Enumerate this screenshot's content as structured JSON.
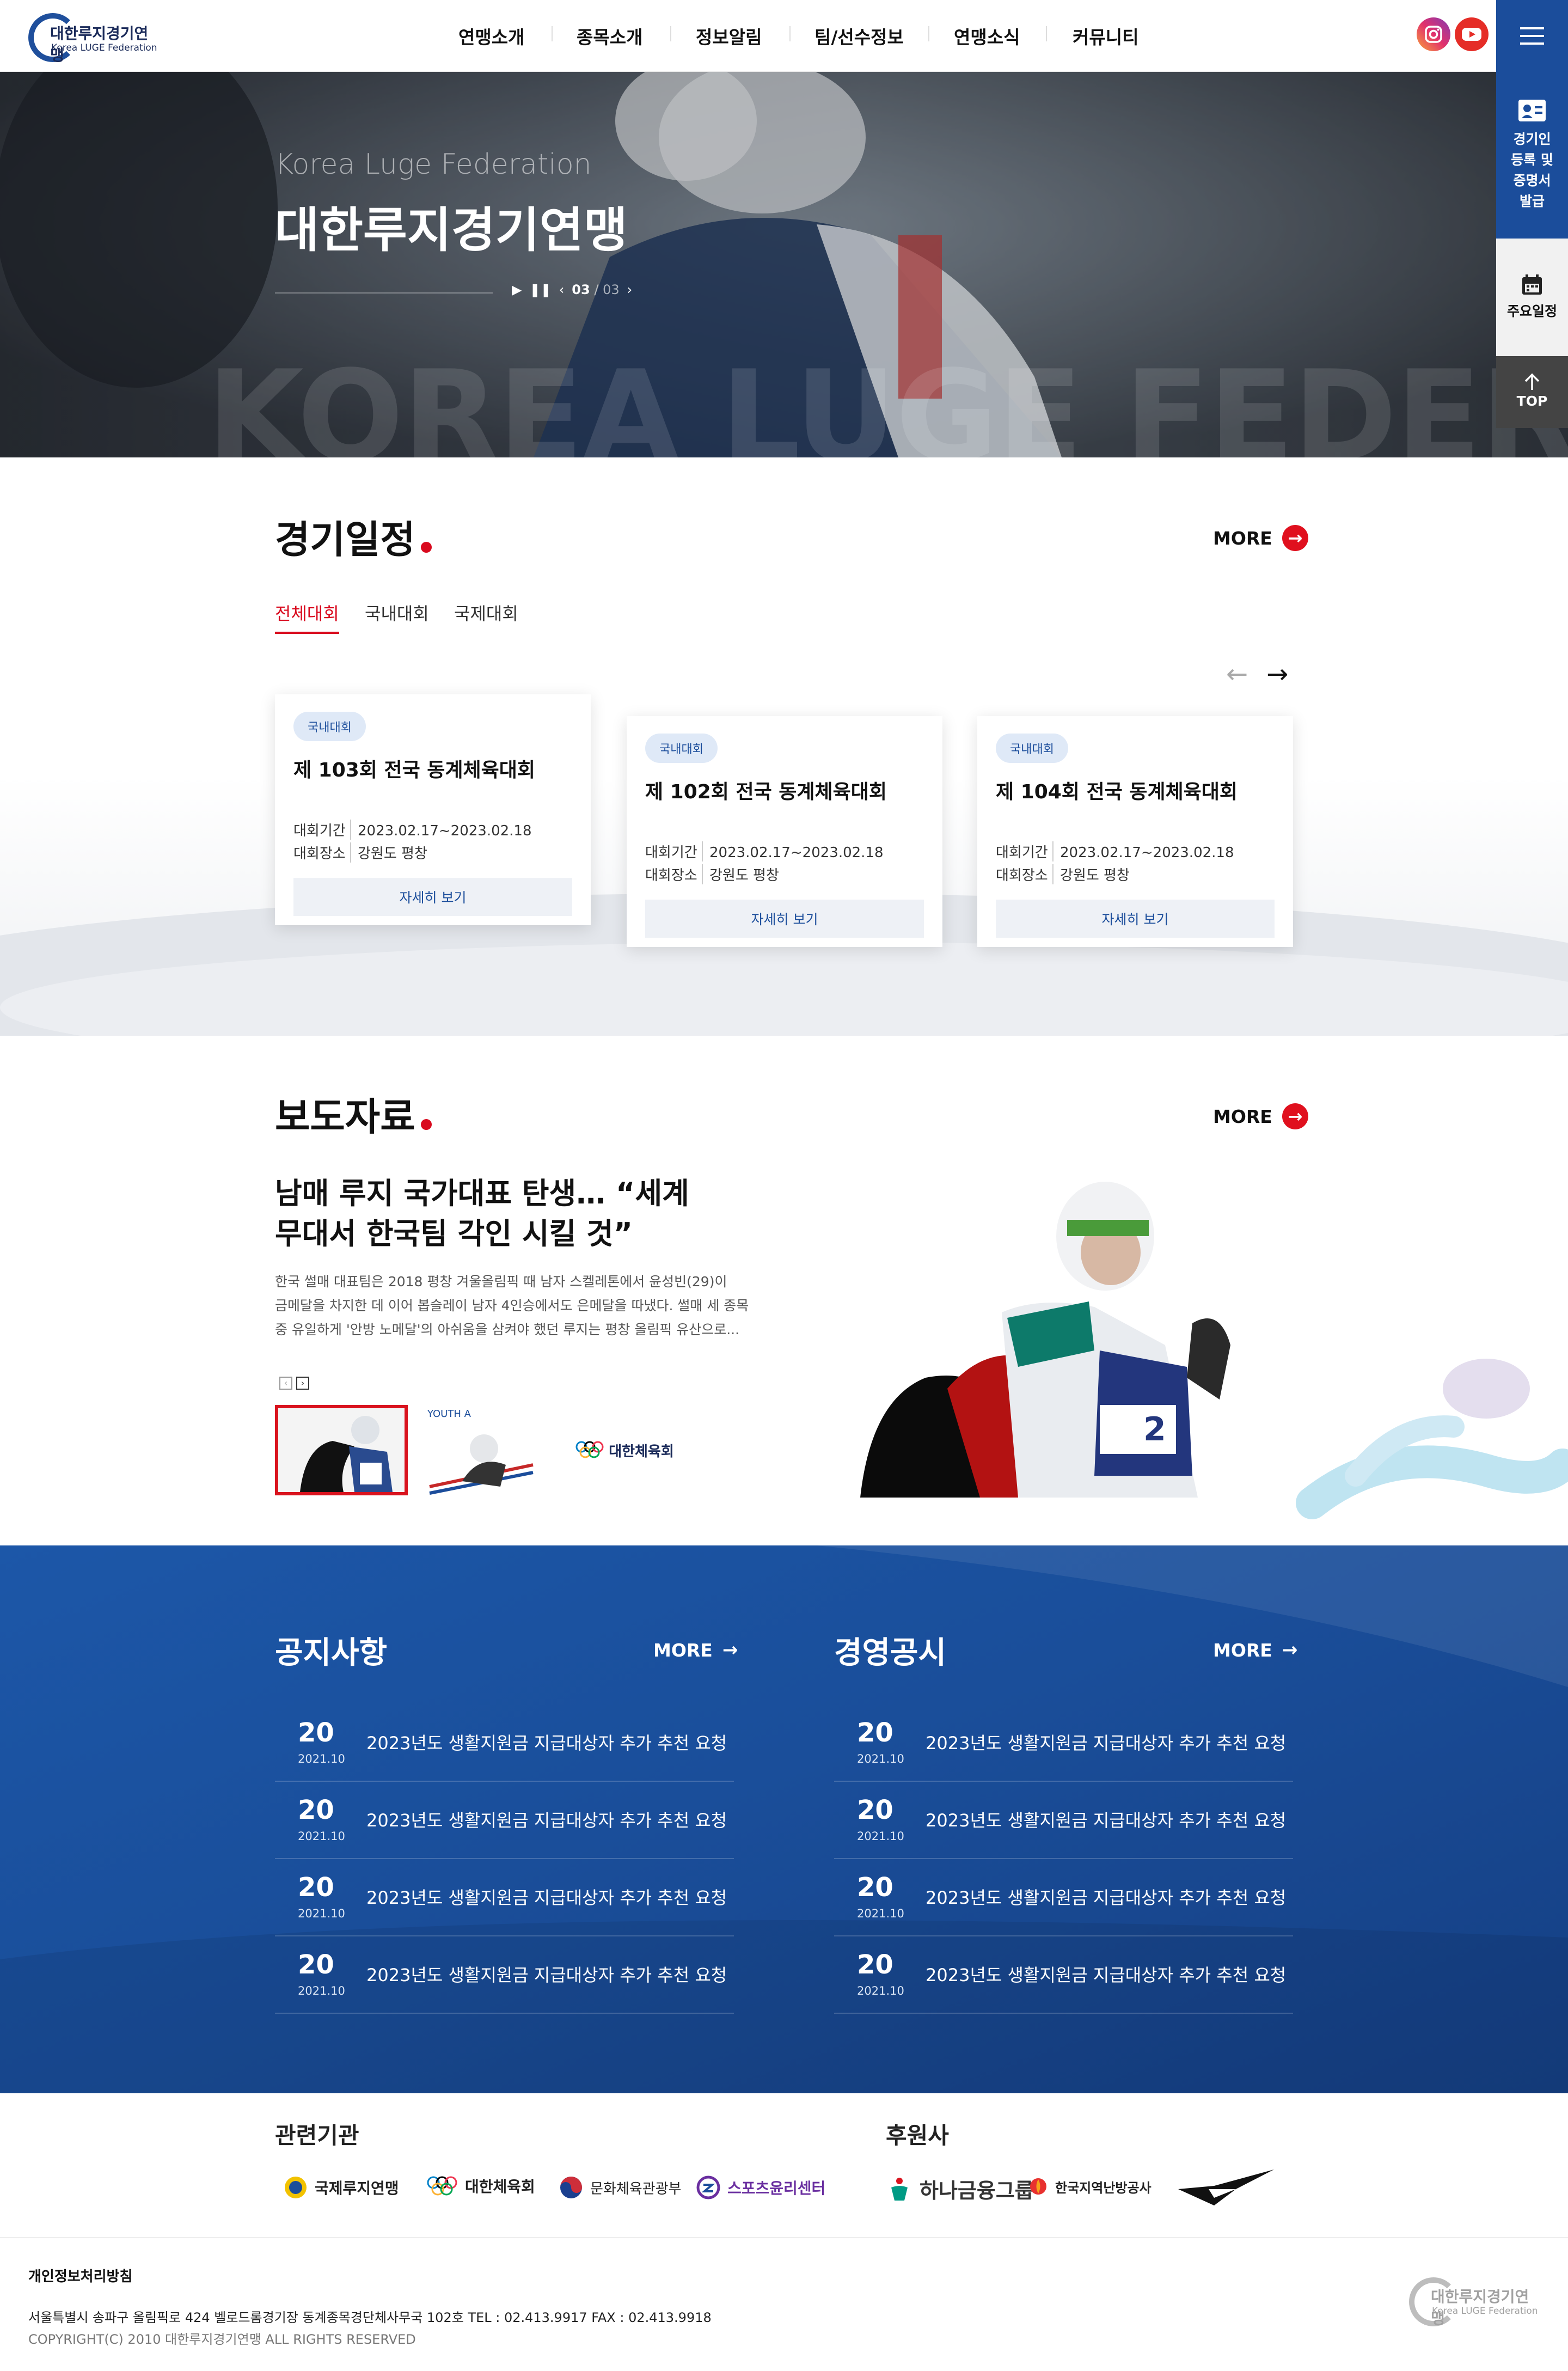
{
  "header": {
    "logo_title": "대한루지경기연맹",
    "logo_sub": "Korea LUGE Federation",
    "nav": [
      "연맹소개",
      "종목소개",
      "정보알림",
      "팀/선수정보",
      "연맹소식",
      "커뮤니티"
    ],
    "sns": [
      "instagram-icon",
      "youtube-icon"
    ]
  },
  "quick_menu": {
    "register_label": "경기인\n등록 및\n증명서\n발급",
    "schedule_label": "주요일정",
    "top_label": "TOP"
  },
  "hero": {
    "subtitle": "Korea Luge Federation",
    "title": "대한루지경기연맹",
    "slide_current": "03",
    "slide_total": "03",
    "watermark": "KOREA LUGE FEDERATI"
  },
  "schedule": {
    "title": "경기일정",
    "more": "MORE",
    "tabs": [
      "전체대회",
      "국내대회",
      "국제대회"
    ],
    "active_tab": 0,
    "cards": [
      {
        "badge": "국내대회",
        "title": "제 103회 전국 동계체육대회",
        "period_label": "대회기간",
        "period": "2023.02.17~2023.02.18",
        "place_label": "대회장소",
        "place": "강원도 평창",
        "button": "자세히 보기"
      },
      {
        "badge": "국내대회",
        "title": "제 102회 전국 동계체육대회",
        "period_label": "대회기간",
        "period": "2023.02.17~2023.02.18",
        "place_label": "대회장소",
        "place": "강원도 평창",
        "button": "자세히 보기"
      },
      {
        "badge": "국내대회",
        "title": "제 104회 전국 동계체육대회",
        "period_label": "대회기간",
        "period": "2023.02.17~2023.02.18",
        "place_label": "대회장소",
        "place": "강원도 평창",
        "button": "자세히 보기"
      }
    ]
  },
  "press": {
    "title": "보도자료",
    "more": "MORE",
    "headline_line1": "남매 루지 국가대표 탄생… “세계",
    "headline_line2": "무대서 한국팀 각인 시킬 것”",
    "body_line1": "한국 썰매 대표팀은 2018 평창 겨울올림픽 때 남자 스켈레톤에서 윤성빈(29)이",
    "body_line2": "금메달을 차지한 데 이어 봅슬레이 남자 4인승에서도 은메달을 따냈다. 썰매 세 종목",
    "body_line3": "중 유일하게 '안방 노메달'의 아쉬움을 삼켜야 했던 루지는 평창 올림픽 유산으로...",
    "thumb2_text": "YOUTH A",
    "thumb3_text": "대한체육회"
  },
  "notice": {
    "title": "공지사항",
    "more": "MORE",
    "items": [
      {
        "day": "20",
        "date": "2021.10",
        "text": "2023년도 생활지원금 지급대상자 추가 추천 요청"
      },
      {
        "day": "20",
        "date": "2021.10",
        "text": "2023년도 생활지원금 지급대상자 추가 추천 요청"
      },
      {
        "day": "20",
        "date": "2021.10",
        "text": "2023년도 생활지원금 지급대상자 추가 추천 요청"
      },
      {
        "day": "20",
        "date": "2021.10",
        "text": "2023년도 생활지원금 지급대상자 추가 추천 요청"
      }
    ]
  },
  "disclosure": {
    "title": "경영공시",
    "more": "MORE",
    "items": [
      {
        "day": "20",
        "date": "2021.10",
        "text": "2023년도 생활지원금 지급대상자 추가 추천 요청"
      },
      {
        "day": "20",
        "date": "2021.10",
        "text": "2023년도 생활지원금 지급대상자 추가 추천 요청"
      },
      {
        "day": "20",
        "date": "2021.10",
        "text": "2023년도 생활지원금 지급대상자 추가 추천 요청"
      },
      {
        "day": "20",
        "date": "2021.10",
        "text": "2023년도 생활지원금 지급대상자 추가 추천 요청"
      }
    ]
  },
  "partners": {
    "related_title": "관련기관",
    "related": [
      "국제루지연맹",
      "대한체육회",
      "문화체육관광부",
      "스포츠윤리센터"
    ],
    "sponsor_title": "후원사",
    "sponsors": [
      "하나금융그룹",
      "한국지역난방공사"
    ]
  },
  "footer": {
    "privacy": "개인정보처리방침",
    "address": "서울특별시 송파구 올림픽로 424 벨로드롬경기장 동계종목경단체사무국 102호 TEL : 02.413.9917 FAX : 02.413.9918",
    "copyright": "COPYRIGHT(C) 2010 대한루지경기연맹 ALL RIGHTS RESERVED",
    "logo_title": "대한루지경기연맹",
    "logo_sub": "Korea LUGE Federation"
  },
  "colors": {
    "brand_blue": "#1b4d9b",
    "accent_red": "#d90a1e",
    "notice_bg": "#1a4e9a"
  }
}
